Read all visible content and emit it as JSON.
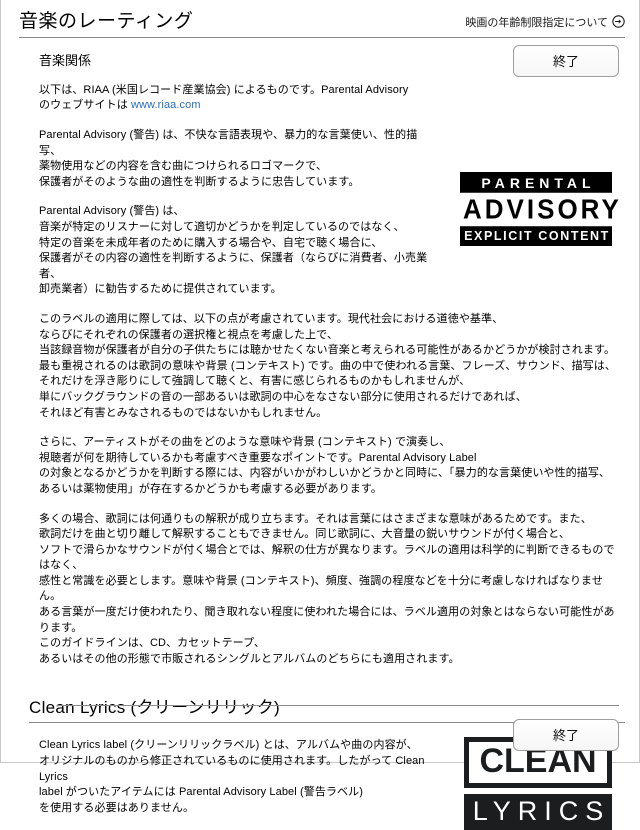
{
  "header": {
    "title": "音楽のレーティング",
    "link_label": "映画の年齢制限指定について",
    "link_icon": "arrow-right-circle-icon"
  },
  "toolbar": {
    "subtitle": "音楽関係",
    "done_label": "終了"
  },
  "main": {
    "paragraphs": [
      {
        "id": "intro",
        "lead": "以下は、RIAA (米国レコード産業協会) によるものです。Parental Advisory\nのウェブサイトは ",
        "link_text": "www.riaa.com"
      },
      {
        "id": "definition",
        "text": "Parental Advisory (警告) は、不快な言語表現や、暴力的な言葉使い、性的描写、\n薬物使用などの内容を含む曲につけられるロゴマークで、\n保護者がそのような曲の適性を判断するように忠告しています。"
      },
      {
        "id": "purpose",
        "text": "Parental Advisory (警告) は、\n音楽が特定のリスナーに対して適切かどうかを判定しているのではなく、\n特定の音楽を未成年者のために購入する場合や、自宅で聴く場合に、\n保護者がその内容の適性を判断するように、保護者（ならびに消費者、小売業者、\n卸売業者）に勧告するために提供されています。"
      },
      {
        "id": "criteria",
        "text": "このラベルの適用に際しては、以下の点が考慮されています。現代社会における道徳や基準、\nならびにそれぞれの保護者の選択権と視点を考慮した上で、\n当該録音物が保護者が自分の子供たちには聴かせたくない音楽と考えられる可能性があるかどうかが検討されます。\n最も重視されるのは歌詞の意味や背景 (コンテキスト) です。曲の中で使われる言葉、フレーズ、サウンド、描写は、\nそれだけを浮き彫りにして強調して聴くと、有害に感じられるものかもしれませんが、\n単にバックグラウンドの音の一部あるいは歌詞の中心をなさない部分に使用されるだけであれば、\nそれほど有害とみなされるものではないかもしれません。"
      },
      {
        "id": "context",
        "text": "さらに、アーティストがその曲をどのような意味や背景 (コンテキスト) で演奏し、\n視聴者が何を期待しているかも考慮すべき重要なポイントです。Parental Advisory Label\nの対象となるかどうかを判断する際には、内容がいかがわしいかどうかと同時に、「暴力的な言葉使いや性的描写、\nあるいは薬物使用」が存在するかどうかも考慮する必要があります。"
      },
      {
        "id": "interpretation",
        "text": "多くの場合、歌詞には何通りもの解釈が成り立ちます。それは言葉にはさまざまな意味があるためです。また、\n歌詞だけを曲と切り離して解釈することもできません。同じ歌詞に、大音量の鋭いサウンドが付く場合と、\nソフトで滑らかなサウンドが付く場合とでは、解釈の仕方が異なります。ラベルの適用は科学的に判断できるものではなく、\n感性と常識を必要とします。意味や背景 (コンテキスト)、頻度、強調の程度などを十分に考慮しなければなりません。\nある言葉が一度だけ使われたり、聞き取れない程度に使われた場合には、ラベル適用の対象とはならない可能性があります。\nこのガイドラインは、CD、カセットテープ、\nあるいはその他の形態で市販されるシングルとアルバムのどちらにも適用されます。"
      }
    ]
  },
  "parental_advisory_logo": {
    "name": "parental-advisory-logo",
    "line1": "PARENTAL",
    "line2": "ADVISORY",
    "line3": "EXPLICIT CONTENT"
  },
  "clean_lyrics_section": {
    "title": "Clean Lyrics (クリーンリリック)",
    "body": "Clean Lyrics label (クリーンリリックラベル) とは、アルバムや曲の内容が、\nオリジナルのものから修正されているものに使用されます。したがって Clean Lyrics\nlabel がついたアイテムには Parental Advisory Label (警告ラベル)\nを使用する必要はありません。",
    "logo": {
      "name": "clean-lyrics-logo",
      "line1": "CLEAN",
      "line2": "LYRICS"
    }
  },
  "footer": {
    "done_label": "終了"
  },
  "colors": {
    "link": "#2b6fb5",
    "rule": "#8c8c8c",
    "logo_black": "#000000",
    "clean_logo_black": "#1b1d1f"
  }
}
